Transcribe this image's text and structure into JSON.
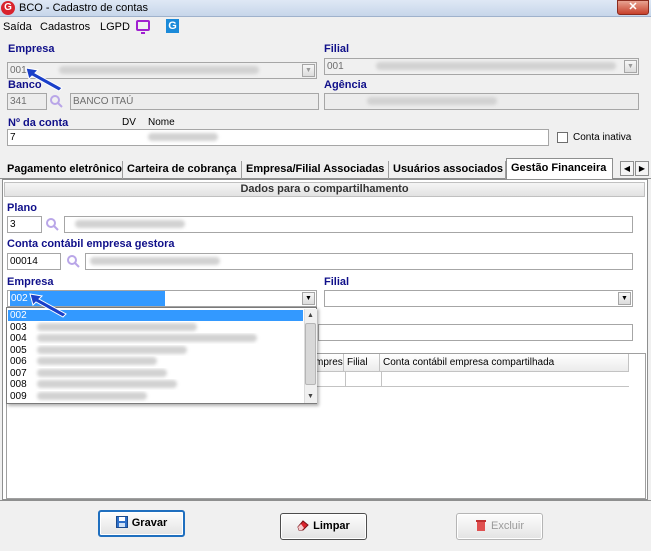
{
  "window": {
    "title": "BCO - Cadastro de contas",
    "app_icon_letter": "G",
    "close_glyph": "✕"
  },
  "menu": {
    "items": [
      "Saída",
      "Cadastros",
      "LGPD"
    ],
    "g_icon_letter": "G"
  },
  "header": {
    "empresa_label": "Empresa",
    "empresa_value": "001",
    "filial_label": "Filial",
    "filial_value": "001",
    "banco_label": "Banco",
    "banco_code": "341",
    "banco_name": "BANCO ITAÚ",
    "agencia_label": "Agência",
    "numero_conta_label": "Nº da conta",
    "dv_label": "DV",
    "nome_label": "Nome",
    "conta_value": "7",
    "conta_inativa_label": "Conta inativa"
  },
  "tabs": [
    {
      "label": "Pagamento eletrônico"
    },
    {
      "label": "Carteira de cobrança"
    },
    {
      "label": "Empresa/Filial Associadas"
    },
    {
      "label": "Usuários associados"
    },
    {
      "label": "Gestão Financeira",
      "active": true
    }
  ],
  "panel": {
    "section_title": "Dados para o compartilhamento",
    "plano_label": "Plano",
    "plano_value": "3",
    "conta_contabil_label": "Conta contábil empresa gestora",
    "conta_contabil_value": "00014",
    "empresa_label": "Empresa",
    "empresa_value": "002",
    "filial_label": "Filial",
    "grid_headers": [
      "mpresa",
      "Filial",
      "Conta contábil empresa compartilhada"
    ]
  },
  "dropdown": {
    "items": [
      "002",
      "003",
      "004",
      "005",
      "006",
      "007",
      "008",
      "009"
    ],
    "selected": "002"
  },
  "buttons": {
    "gravar": "Gravar",
    "limpar": "Limpar",
    "excluir": "Excluir"
  },
  "colors": {
    "accent": "#3399ff",
    "label_blue": "#10108a",
    "lgpd_purple": "#a020d0",
    "brand_red": "#d9232d"
  }
}
